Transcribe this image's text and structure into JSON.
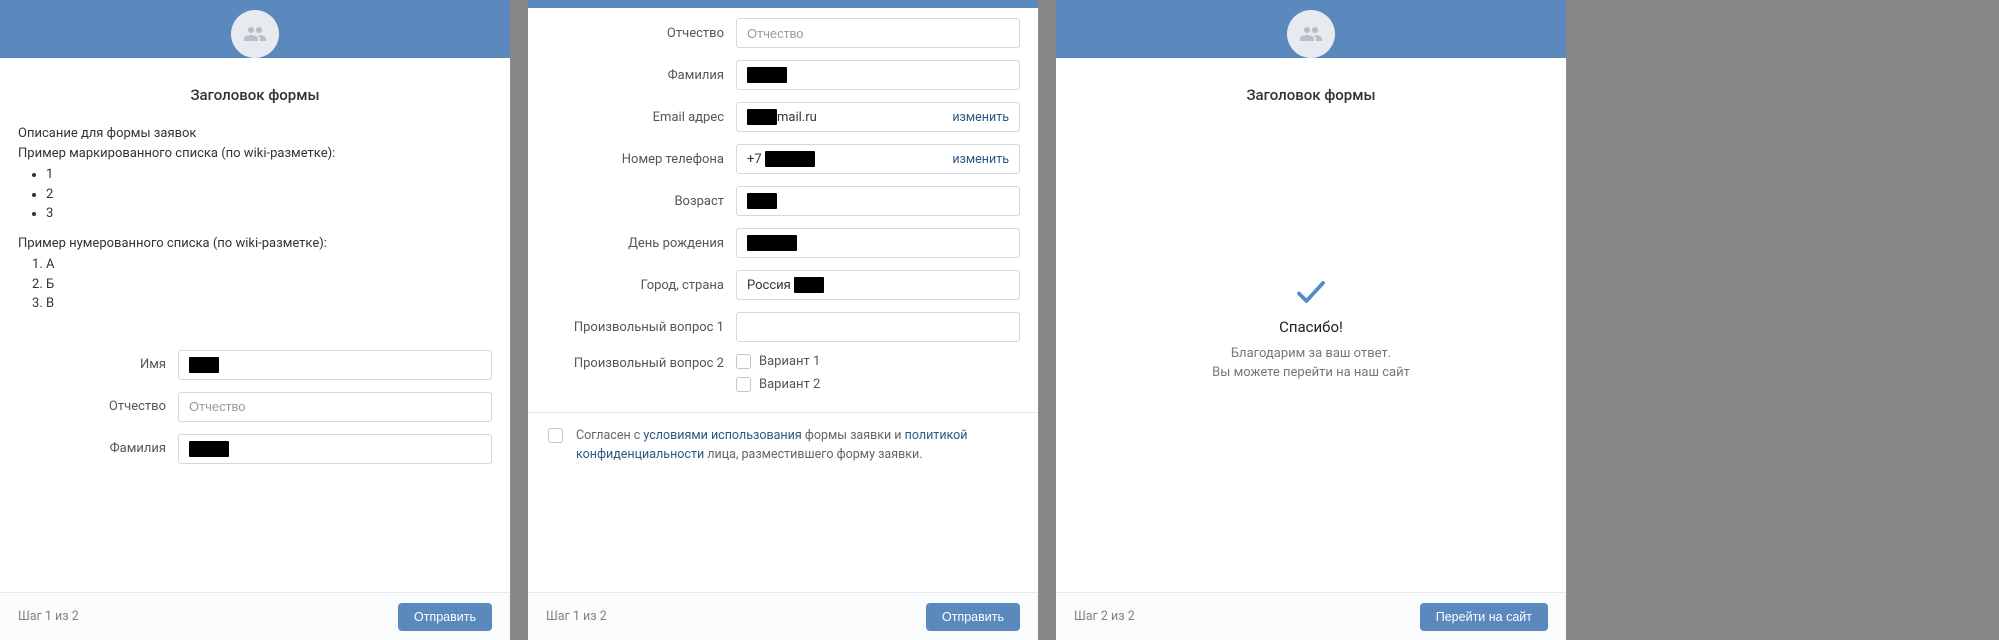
{
  "panel1": {
    "form_title": "Заголовок формы",
    "desc1": "Описание для формы заявок",
    "desc2": "Пример маркированного списка (по wiki-разметке):",
    "ul": [
      "1",
      "2",
      "3"
    ],
    "desc3": "Пример нумерованного списка (по wiki-разметке):",
    "ol": [
      "А",
      "Б",
      "В"
    ],
    "fields": {
      "name_label": "Имя",
      "patr_label": "Отчество",
      "patr_placeholder": "Отчество",
      "lastname_label": "Фамилия"
    },
    "footer": {
      "step": "Шаг 1 из 2",
      "submit": "Отправить"
    }
  },
  "panel2": {
    "fields": {
      "patr_label": "Отчество",
      "patr_placeholder": "Отчество",
      "lastname_label": "Фамилия",
      "email_label": "Email адрес",
      "email_domain": "mail.ru",
      "change": "изменить",
      "phone_label": "Номер телефона",
      "phone_prefix": "+7",
      "age_label": "Возраст",
      "bday_label": "День рождения",
      "city_label": "Город, страна",
      "country_text": "Россия",
      "q1_label": "Произвольный вопрос 1",
      "q2_label": "Произвольный вопрос 2",
      "opt1": "Вариант 1",
      "opt2": "Вариант 2"
    },
    "consent": {
      "t1": "Согласен с ",
      "link1": "условиями использования",
      "t2": " формы заявки и ",
      "link2": "политикой конфиденциальности",
      "t3": " лица, разместившего форму заявки."
    },
    "footer": {
      "step": "Шаг 1 из 2",
      "submit": "Отправить"
    }
  },
  "panel3": {
    "form_title": "Заголовок формы",
    "thanks_title": "Спасибо!",
    "thanks_line1": "Благодарим за ваш ответ.",
    "thanks_line2": "Вы можете перейти на наш сайт",
    "footer": {
      "step": "Шаг 2 из 2",
      "goto": "Перейти на сайт"
    }
  }
}
